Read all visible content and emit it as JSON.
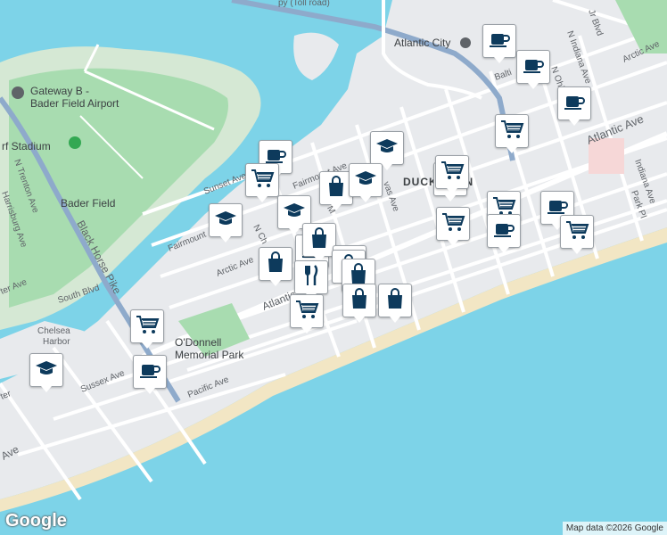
{
  "map": {
    "labels": {
      "toll_road": "py (Toll road)",
      "atlantic_city": "Atlantic City",
      "mlk": "Jr Blvd",
      "arctic_ave_e": "Arctic Ave",
      "indiana": "N Indiana Ave",
      "baltic": "Balti",
      "ohio": "N Ohi",
      "atlantic_ave_e": "Atlantic Ave",
      "indiana_s": "Indiana Ave",
      "park_pl": "Park Pl",
      "airport": "Gateway B - Bader Field Airport",
      "airport_l1": "Gateway B -",
      "airport_l2": "Bader Field Airport",
      "stadium": "rf Stadium",
      "n_trenton": "N Trenton Ave",
      "harrisburg": "Harrisburg Ave",
      "bader_field": "Bader Field",
      "black_horse": "Black Horse Pike",
      "sunset": "Sunset Ave",
      "fairmount": "Fairmount Ave",
      "fairmount2": "Fairmount",
      "arctic_w": "Arctic Ave",
      "ducktown": "DUCKTOWN",
      "vas": "vas Ave",
      "n_ch": "N Ch",
      "n_m": "N M",
      "south_blvd": "South Blvd",
      "ter_ave": "ter Ave",
      "atlantic_w": "Atlantic",
      "chelsea_harbor_1": "Chelsea",
      "chelsea_harbor_2": "Harbor",
      "odonnell_1": "O'Donnell",
      "odonnell_2": "Memorial Park",
      "sussex": "Sussex Ave",
      "pacific": "Pacific Ave",
      "ave_sw": "Ave",
      "ter": "ter"
    },
    "branding": "Google",
    "attribution": "Map data ©2026 Google"
  },
  "pins": [
    {
      "type": "coffee",
      "name": "coffee-pin"
    },
    {
      "type": "coffee",
      "name": "coffee-pin"
    },
    {
      "type": "coffee",
      "name": "coffee-pin"
    },
    {
      "type": "cart",
      "name": "grocery-pin"
    },
    {
      "type": "school",
      "name": "school-pin"
    },
    {
      "type": "coffee",
      "name": "coffee-pin"
    },
    {
      "type": "cart",
      "name": "grocery-pin"
    },
    {
      "type": "cart",
      "name": "grocery-pin"
    },
    {
      "type": "bag",
      "name": "shopping-pin"
    },
    {
      "type": "school",
      "name": "school-pin"
    },
    {
      "type": "cart",
      "name": "grocery-pin"
    },
    {
      "type": "cart",
      "name": "grocery-pin"
    },
    {
      "type": "coffee",
      "name": "coffee-pin"
    },
    {
      "type": "cart",
      "name": "grocery-pin"
    },
    {
      "type": "cart",
      "name": "grocery-pin"
    },
    {
      "type": "school",
      "name": "school-pin"
    },
    {
      "type": "school",
      "name": "school-pin"
    },
    {
      "type": "coffee",
      "name": "coffee-pin"
    },
    {
      "type": "bag",
      "name": "shopping-pin"
    },
    {
      "type": "coffee",
      "name": "coffee-pin"
    },
    {
      "type": "bag",
      "name": "shopping-pin"
    },
    {
      "type": "restaurant",
      "name": "restaurant-pin"
    },
    {
      "type": "bag",
      "name": "shopping-pin"
    },
    {
      "type": "restaurant",
      "name": "restaurant-pin"
    },
    {
      "type": "bag",
      "name": "shopping-pin"
    },
    {
      "type": "bag",
      "name": "shopping-pin"
    },
    {
      "type": "cart",
      "name": "grocery-pin"
    },
    {
      "type": "bag",
      "name": "shopping-pin"
    },
    {
      "type": "cart",
      "name": "grocery-pin"
    },
    {
      "type": "school",
      "name": "school-pin"
    },
    {
      "type": "coffee",
      "name": "coffee-pin"
    }
  ],
  "colors": {
    "water": "#7dd3e8",
    "land": "#e8eaed",
    "beach": "#f2e6c4",
    "park": "#a8dcb0",
    "road": "#ffffff",
    "highway": "#8eaacb",
    "pin_icon": "#0d3a5c"
  }
}
